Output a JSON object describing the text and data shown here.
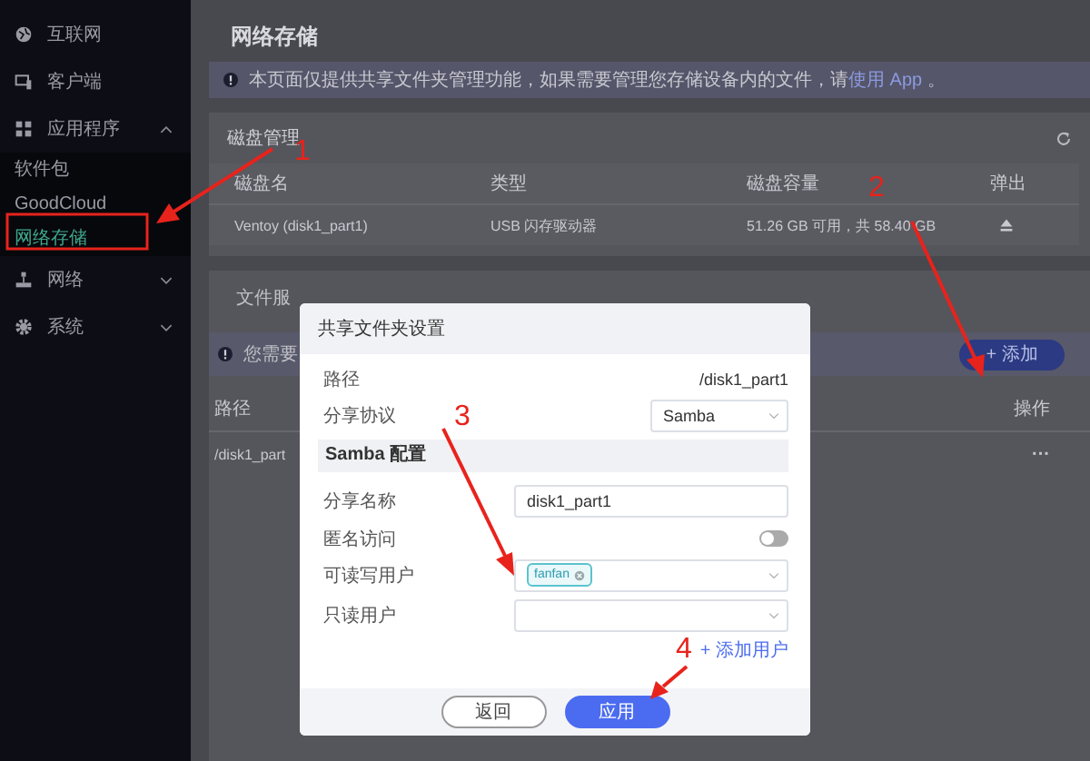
{
  "sidebar": {
    "items": [
      {
        "label": "互联网",
        "selected": false
      },
      {
        "label": "客户端",
        "selected": false
      },
      {
        "label": "应用程序",
        "selected": false,
        "expanded": true,
        "children": [
          {
            "label": "软件包",
            "selected": false
          },
          {
            "label": "GoodCloud",
            "selected": false
          },
          {
            "label": "网络存储",
            "selected": true
          }
        ]
      },
      {
        "label": "网络",
        "selected": false,
        "expanded": false
      },
      {
        "label": "系统",
        "selected": false,
        "expanded": false
      }
    ]
  },
  "page_title": "网络存储",
  "notice": {
    "text": "本页面仅提供共享文件夹管理功能，如果需要管理您存储设备内的文件，请",
    "link": "使用 App",
    "suffix": " 。"
  },
  "disk_management": {
    "title": "磁盘管理",
    "columns": [
      "磁盘名",
      "类型",
      "磁盘容量",
      "弹出"
    ],
    "rows": [
      {
        "name": "Ventoy (disk1_part1)",
        "type": "USB 闪存驱动器",
        "capacity": "51.26 GB 可用，共 58.40 GB"
      }
    ]
  },
  "file_service": {
    "tab": "文件服",
    "notice": "您需要",
    "add_button": "+ 添加",
    "columns": [
      "路径",
      "操作"
    ],
    "rows": [
      {
        "path": "/disk1_part",
        "actions": "···"
      }
    ]
  },
  "dialog": {
    "title": "共享文件夹设置",
    "path_label": "路径",
    "path": "/disk1_part1",
    "protocol_label": "分享协议",
    "protocol": "Samba",
    "section": "Samba 配置",
    "share_name_label": "分享名称",
    "share_name": "disk1_part1",
    "anonymous_label": "匿名访问",
    "anonymous": false,
    "rw_users_label": "可读写用户",
    "rw_users": [
      "fanfan"
    ],
    "ro_users_label": "只读用户",
    "add_user": "+ 添加用户",
    "buttons": [
      {
        "label": "返回",
        "kind": "secondary"
      },
      {
        "label": "应用",
        "kind": "primary"
      }
    ]
  },
  "annotations": [
    {
      "label": "1"
    },
    {
      "label": "2"
    },
    {
      "label": "3"
    },
    {
      "label": "4"
    }
  ]
}
